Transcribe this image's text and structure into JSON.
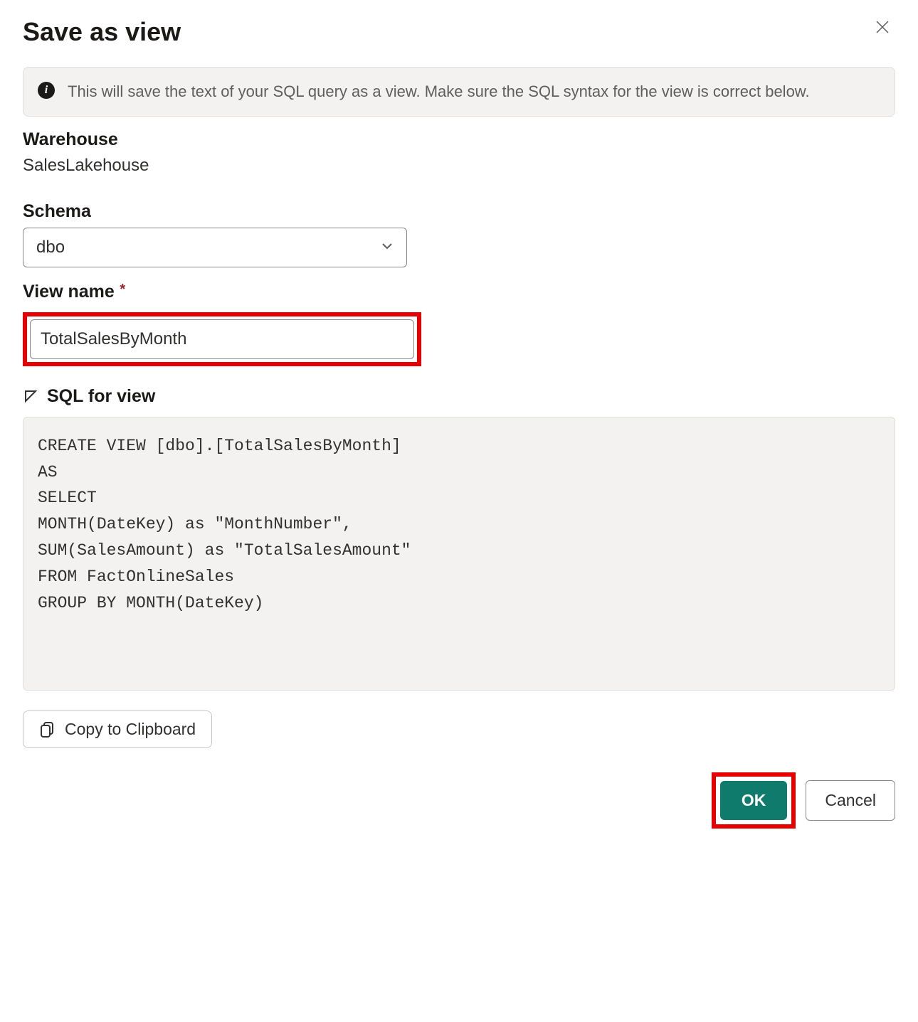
{
  "dialog": {
    "title": "Save as view",
    "infoText": "This will save the text of your SQL query as a view. Make sure the SQL syntax for the view is correct below."
  },
  "warehouse": {
    "label": "Warehouse",
    "value": "SalesLakehouse"
  },
  "schema": {
    "label": "Schema",
    "selected": "dbo"
  },
  "viewName": {
    "label": "View name",
    "value": "TotalSalesByMonth"
  },
  "sqlSection": {
    "label": "SQL for view",
    "code": "CREATE VIEW [dbo].[TotalSalesByMonth]\nAS\nSELECT\nMONTH(DateKey) as \"MonthNumber\",\nSUM(SalesAmount) as \"TotalSalesAmount\"\nFROM FactOnlineSales\nGROUP BY MONTH(DateKey)"
  },
  "buttons": {
    "copy": "Copy to Clipboard",
    "ok": "OK",
    "cancel": "Cancel"
  }
}
